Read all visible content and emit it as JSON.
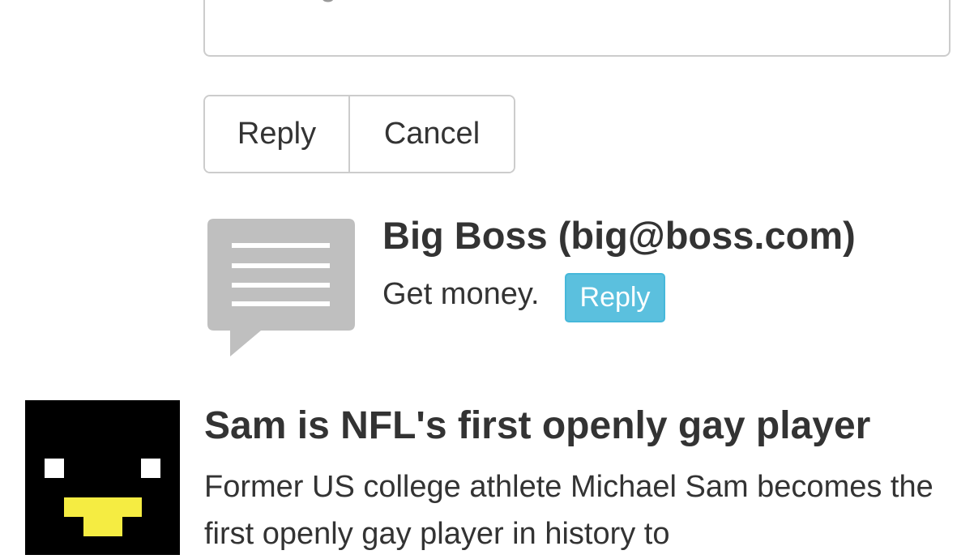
{
  "reply_form": {
    "message_placeholder": "Message",
    "reply_label": "Reply",
    "cancel_label": "Cancel"
  },
  "comment": {
    "icon": "comment-bubble-icon",
    "author": "Big Boss (big@boss.com)",
    "text": "Get money.",
    "reply_label": "Reply",
    "reply_color": "#5bc0de"
  },
  "news": {
    "avatar": "pixel-penguin-avatar",
    "title": "Sam is NFL's first openly gay player",
    "body": "Former US college athlete Michael Sam becomes the first openly gay player in history to"
  }
}
